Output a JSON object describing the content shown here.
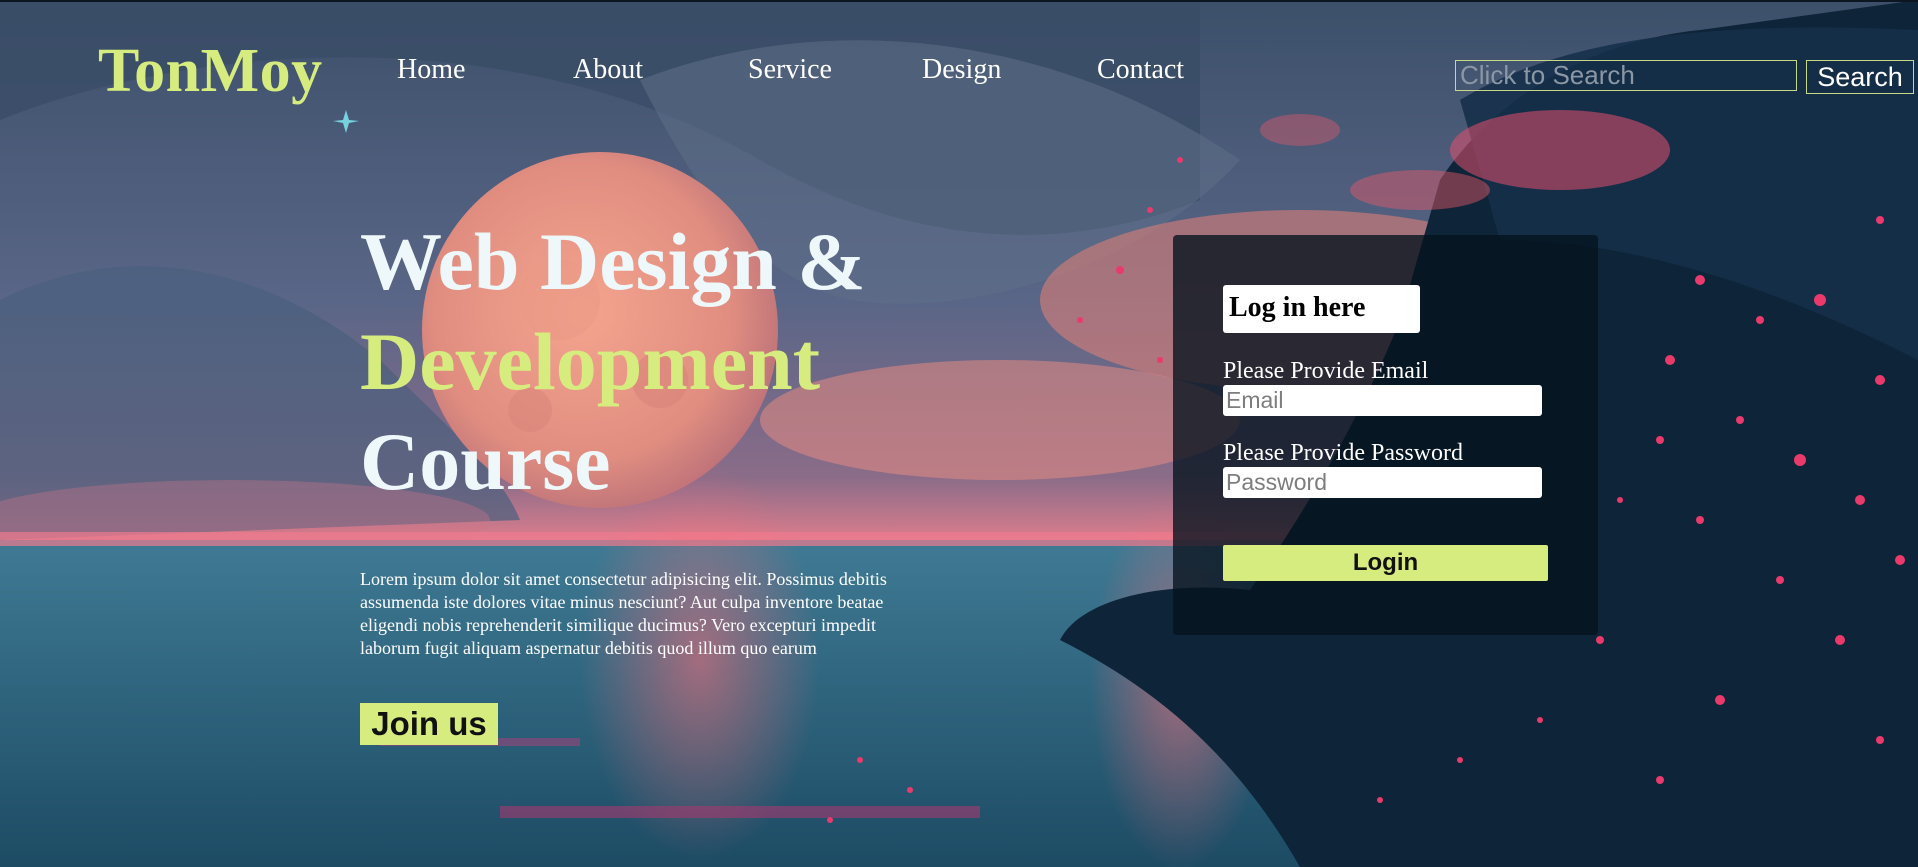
{
  "header": {
    "logo": "TonMoy",
    "nav": [
      {
        "label": "Home"
      },
      {
        "label": "About"
      },
      {
        "label": "Service"
      },
      {
        "label": "Design"
      },
      {
        "label": "Contact"
      }
    ],
    "search": {
      "placeholder": "Click to Search",
      "value": "",
      "button_label": "Search"
    }
  },
  "hero": {
    "line1": "Web Design &",
    "line2": "Development",
    "line3": "Course",
    "description": "Lorem ipsum dolor sit amet consectetur adipisicing elit. Possimus debitis assumenda iste dolores vitae minus nesciunt? Aut culpa inventore beatae eligendi nobis reprehenderit similique ducimus? Vero excepturi impedit laborum fugit aliquam aspernatur debitis quod illum quo earum",
    "cta_label": "Join us"
  },
  "login": {
    "title": "Log in here",
    "email_label": "Please Provide Email",
    "email_placeholder": "Email",
    "password_label": "Please Provide Password",
    "password_placeholder": "Password",
    "submit_label": "Login"
  },
  "colors": {
    "accent": "#d7ec7e",
    "heading_text": "#eef7fa",
    "panel_background": "#04121e"
  }
}
